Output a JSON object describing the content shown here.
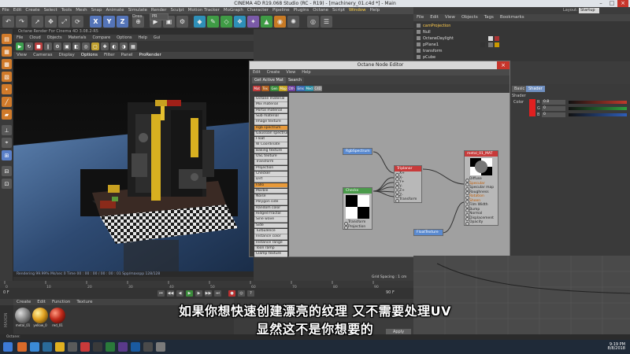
{
  "window": {
    "title": "CINEMA 4D R19.068 Studio (RC - R19) - [machinery_01.c4d *] - Main"
  },
  "main_menu": [
    "File",
    "Edit",
    "Create",
    "Select",
    "Tools",
    "Mesh",
    "Snap",
    "Animate",
    "Simulate",
    "Render",
    "Sculpt",
    "Motion Tracker",
    "MoGraph",
    "Character",
    "Pipeline",
    "Plugins",
    "Octane",
    "Script",
    "Window",
    "Help"
  ],
  "toolbar": {
    "x_label": "X",
    "y_label": "Y",
    "z_label": "Z"
  },
  "octane_window": {
    "title": "Octane Render For Cinema 4D 3.08.2-R5",
    "menu": [
      "File",
      "Cloud",
      "Objects",
      "Materials",
      "Compare",
      "Options",
      "Help",
      "Gui"
    ],
    "res_label": "Dres",
    "res_value": "PR"
  },
  "viewport": {
    "menu": [
      "View",
      "Cameras",
      "Display",
      "Options",
      "Filter",
      "Panel",
      "ProRender"
    ],
    "status": "Rendering 99.99% Ms/sec 0 Time 00 : 00 : 00 / 00 : 00 : 01 Spp/maxspp 128/128"
  },
  "object_manager": {
    "menu": [
      "File",
      "Edit",
      "View",
      "Objects",
      "Tags",
      "Bookmarks"
    ],
    "objects": [
      "camProjection",
      "Null",
      "OctaneDaylight",
      "pPlane1",
      "transform",
      "pCube"
    ],
    "layout_label": "Layout:",
    "layout_value": "Startup"
  },
  "node_editor": {
    "title": "Octane Node Editor",
    "menu": [
      "Edit",
      "Create",
      "View",
      "Help"
    ],
    "buttons": [
      "Get Active Mat",
      "Search"
    ],
    "categories": [
      "Mat",
      "Tex",
      "Gen",
      "Map",
      "Oth",
      "Ems",
      "Med",
      "C4D"
    ],
    "category_colors": [
      "#c03a3a",
      "#b06020",
      "#3a8a3a",
      "#c0a020",
      "#7040a0",
      "#3a6ab0",
      "#2a8aa0",
      "#808080"
    ],
    "node_list": [
      "Octane material",
      "Mix material",
      "Portal material",
      "Sub material",
      "Image texture",
      "Rgb spectrum",
      "Gaussian spectrum",
      "Float",
      "W Coordinate",
      "Baking texture",
      "OSL texture",
      "Transform",
      "Projection",
      "Checker",
      "Dirt",
      "Fallo",
      "Marble",
      "Noise",
      "Polygon side",
      "Random color",
      "Ridged fractal",
      "Sine wave",
      "Side",
      "Turbulence",
      "Instance color",
      "Instance range",
      "Toon ramp",
      "Clamp texture"
    ],
    "nodes": {
      "rgb": {
        "title": "RgbSpectrum"
      },
      "checks": {
        "title": "Checks",
        "pins": [
          "Transform",
          "Projection"
        ]
      },
      "triplanar": {
        "title": "Triplanar",
        "pins": [
          "X+",
          "X-",
          "Y+",
          "Y-",
          "Z+",
          "Z-",
          "Transform"
        ]
      },
      "float": {
        "title": "FloatTexture"
      },
      "material": {
        "title": "metal_01_MAT",
        "pins": [
          "Diffuse",
          "Specular",
          "Specular map",
          "Roughness",
          "Rotation",
          "Sheen",
          "Film Width",
          "Bump",
          "Normal",
          "Displacement",
          "Opacity"
        ]
      }
    }
  },
  "attribute_panel": {
    "tabs": [
      "Basic",
      "Shader"
    ],
    "section": "Shader",
    "color_label": "Color",
    "channels": [
      {
        "label": "R",
        "value": "0.8",
        "color": "#c0392b"
      },
      {
        "label": "G",
        "value": "0",
        "color": "#2e9e3e"
      },
      {
        "label": "B",
        "value": "0",
        "color": "#2e5eb8"
      }
    ]
  },
  "viewport_grid": "Grid Spacing : 1 cm",
  "timeline": {
    "frames": [
      "0",
      "10",
      "20",
      "30",
      "40",
      "50",
      "60",
      "70",
      "80",
      "90"
    ],
    "current_frame": "0 F",
    "end_frame": "90 F"
  },
  "material_manager": {
    "menu": [
      "Create",
      "Edit",
      "Function",
      "Texture"
    ],
    "side_label": "MAXON CINEMA 4D",
    "materials": [
      {
        "name": "metal_01",
        "color": "#8a8a8a"
      },
      {
        "name": "yellow_0",
        "color": "#e0a020"
      },
      {
        "name": "red_01",
        "color": "#c02a1a"
      }
    ]
  },
  "apply_label": "Apply",
  "status_bar": "Octane:",
  "taskbar": {
    "time": "9:19 PM",
    "date": "8/8/2018"
  },
  "subtitles": {
    "line1": "如果你想快速创建漂亮的纹理 又不需要处理UV",
    "line2": "显然这不是你想要的"
  }
}
